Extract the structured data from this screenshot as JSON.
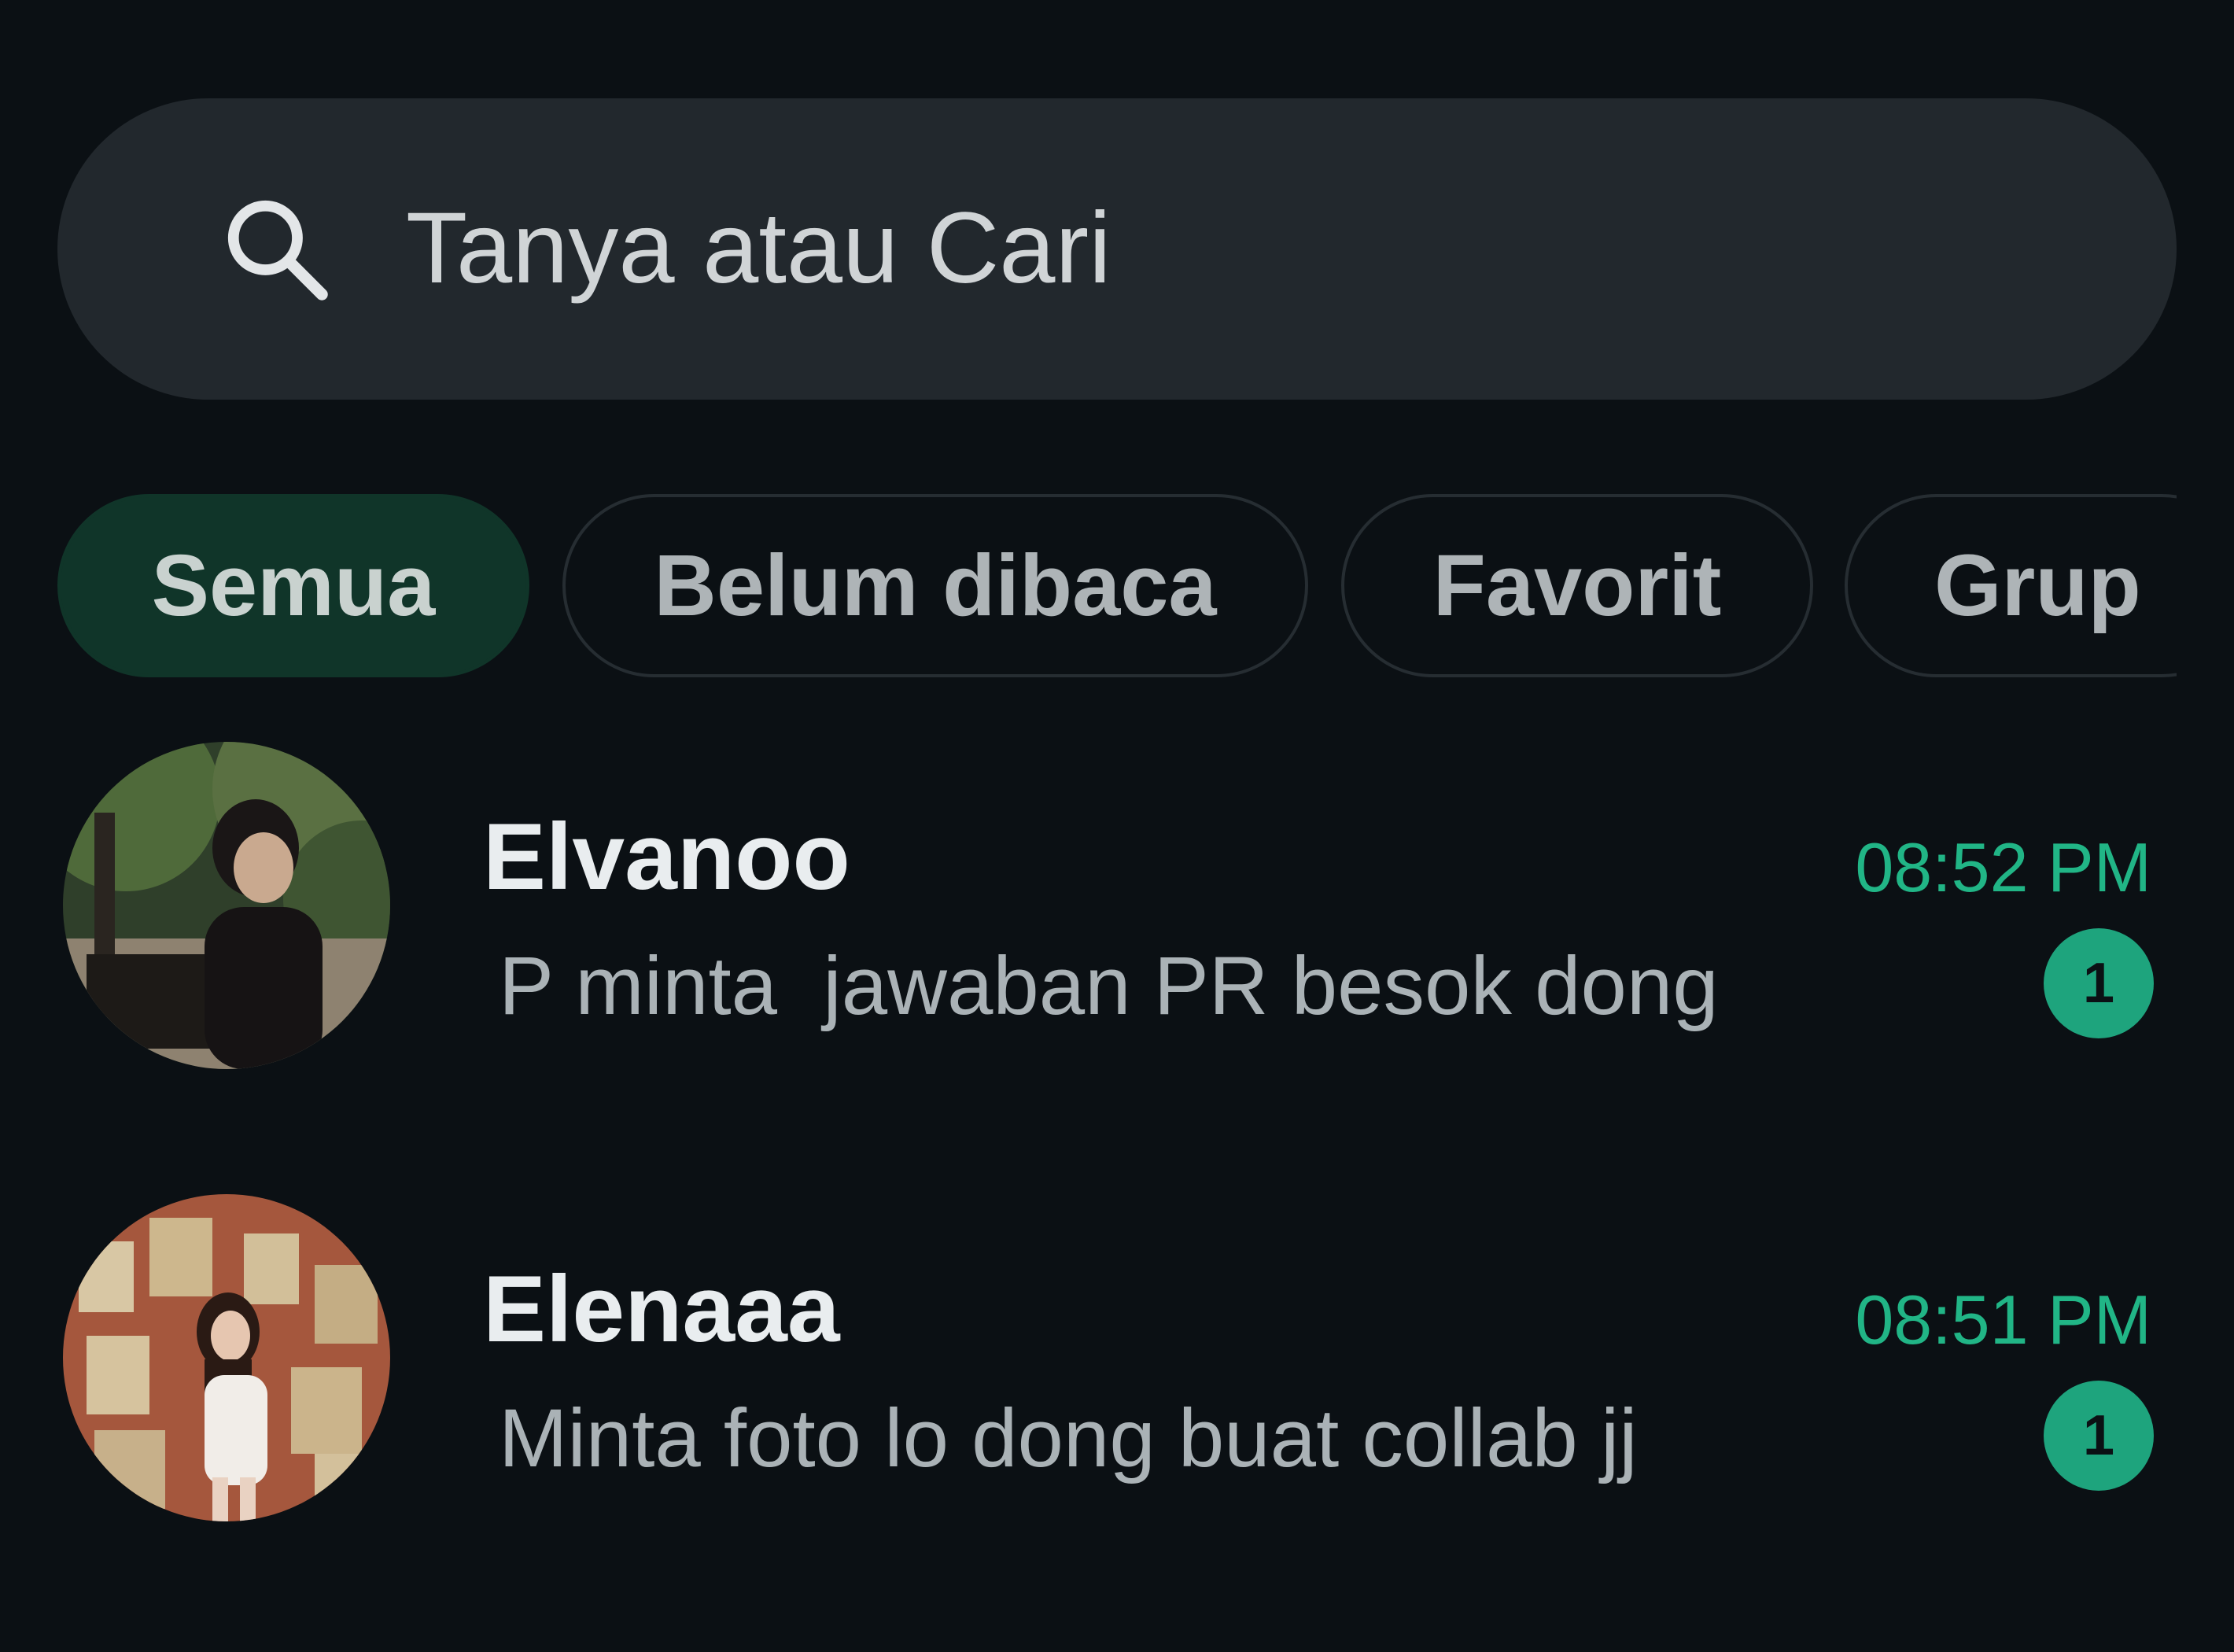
{
  "search": {
    "placeholder": "Tanya atau Cari",
    "icon": "search-icon"
  },
  "filters": {
    "active": "Semua",
    "items": [
      {
        "label": "Semua"
      },
      {
        "label": "Belum dibaca"
      },
      {
        "label": "Favorit"
      },
      {
        "label": "Grup"
      }
    ]
  },
  "chats": [
    {
      "name": "Elvanoo",
      "preview": "P minta  jawaban PR besok dong",
      "time": "08:52 PM",
      "unread": "1"
    },
    {
      "name": "Elenaaa",
      "preview": "Minta foto lo dong buat collab jj",
      "time": "08:51 PM",
      "unread": "1"
    }
  ],
  "colors": {
    "background": "#0b1014",
    "search_bg": "#22282d",
    "active_chip": "#103529",
    "accent": "#21b586",
    "badge": "#1ea47d"
  }
}
